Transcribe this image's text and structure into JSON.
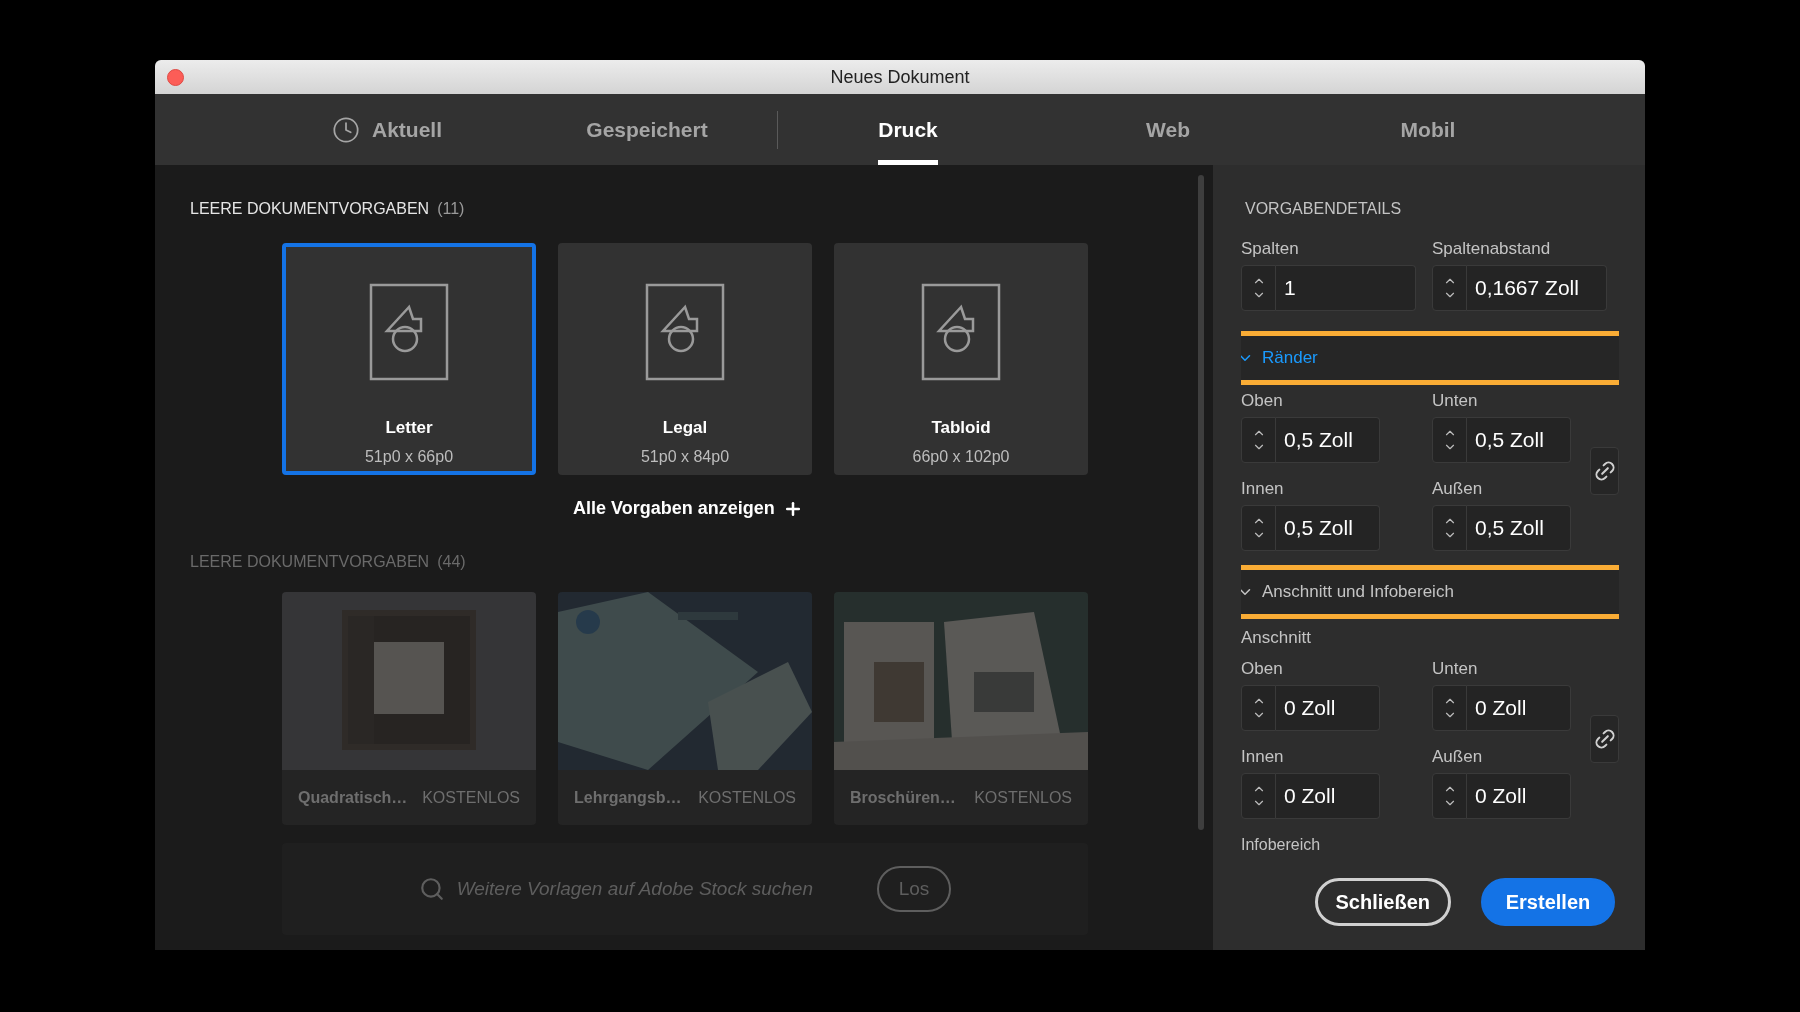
{
  "window": {
    "title": "Neues Dokument"
  },
  "tabs": [
    {
      "label": "Aktuell",
      "icon": true,
      "selected": false
    },
    {
      "label": "Gespeichert",
      "icon": false,
      "selected": false
    },
    {
      "label": "Druck",
      "icon": false,
      "selected": true
    },
    {
      "label": "Web",
      "icon": false,
      "selected": false
    },
    {
      "label": "Mobil",
      "icon": false,
      "selected": false
    }
  ],
  "presets": {
    "title": "LEERE DOKUMENTVORGABEN",
    "count": "(11)",
    "show_all": "Alle Vorgaben anzeigen",
    "items": [
      {
        "name": "Letter",
        "size": "51p0 x 66p0",
        "selected": true
      },
      {
        "name": "Legal",
        "size": "51p0 x 84p0",
        "selected": false
      },
      {
        "name": "Tabloid",
        "size": "66p0 x 102p0",
        "selected": false
      }
    ]
  },
  "templates": {
    "title": "LEERE DOKUMENTVORGABEN",
    "count": "(44)",
    "items": [
      {
        "name": "Quadratisch…",
        "price": "KOSTENLOS"
      },
      {
        "name": "Lehrgangsb…",
        "price": "KOSTENLOS"
      },
      {
        "name": "Broschüren…",
        "price": "KOSTENLOS"
      }
    ]
  },
  "stock_search": {
    "placeholder": "Weitere Vorlagen auf Adobe Stock suchen",
    "button": "Los"
  },
  "details": {
    "title": "VORGABENDETAILS",
    "top_fields": [
      {
        "label": "Spalten",
        "value": "1"
      },
      {
        "label": "Spaltenabstand",
        "value": "0,1667 Zoll"
      }
    ],
    "sections": [
      {
        "title": "Ränder",
        "expanded": true,
        "active": true,
        "highlighted": true,
        "fields": [
          {
            "label": "Oben",
            "value": "0,5 Zoll"
          },
          {
            "label": "Unten",
            "value": "0,5 Zoll"
          },
          {
            "label": "Innen",
            "value": "0,5 Zoll"
          },
          {
            "label": "Außen",
            "value": "0,5 Zoll"
          }
        ]
      },
      {
        "title": "Anschnitt und Infobereich",
        "expanded": true,
        "active": false,
        "highlighted": true,
        "subtitle": "Anschnitt",
        "fields": [
          {
            "label": "Oben",
            "value": "0 Zoll"
          },
          {
            "label": "Unten",
            "value": "0 Zoll"
          },
          {
            "label": "Innen",
            "value": "0 Zoll"
          },
          {
            "label": "Außen",
            "value": "0 Zoll"
          }
        ]
      }
    ],
    "info_label": "Infobereich"
  },
  "buttons": [
    {
      "label": "Schließen",
      "kind": "secondary"
    },
    {
      "label": "Erstellen",
      "kind": "primary"
    }
  ]
}
